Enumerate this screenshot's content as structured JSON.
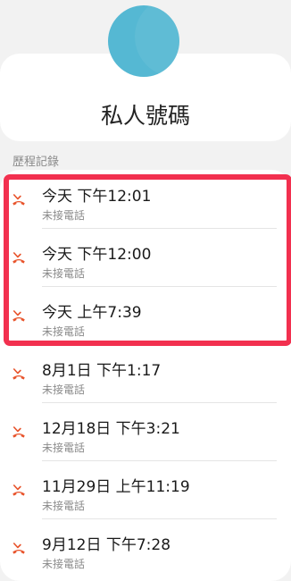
{
  "contact": {
    "name": "私人號碼"
  },
  "history": {
    "title": "歷程記錄",
    "items": [
      {
        "time": "今天 下午12:01",
        "status": "未接電話"
      },
      {
        "time": "今天 下午12:00",
        "status": "未接電話"
      },
      {
        "time": "今天 上午7:39",
        "status": "未接電話"
      },
      {
        "time": "8月1日 下午1:17",
        "status": "未接電話"
      },
      {
        "time": "12月18日 下午3:21",
        "status": "未接電話"
      },
      {
        "time": "11月29日 上午11:19",
        "status": "未接電話"
      },
      {
        "time": "9月12日 下午7:28",
        "status": "未接電話"
      }
    ]
  },
  "colors": {
    "avatar": "#55b8d3",
    "missed_call_icon": "#e8542c",
    "highlight": "#f2304f"
  },
  "icons": {
    "call_item": "missed-call-icon"
  }
}
